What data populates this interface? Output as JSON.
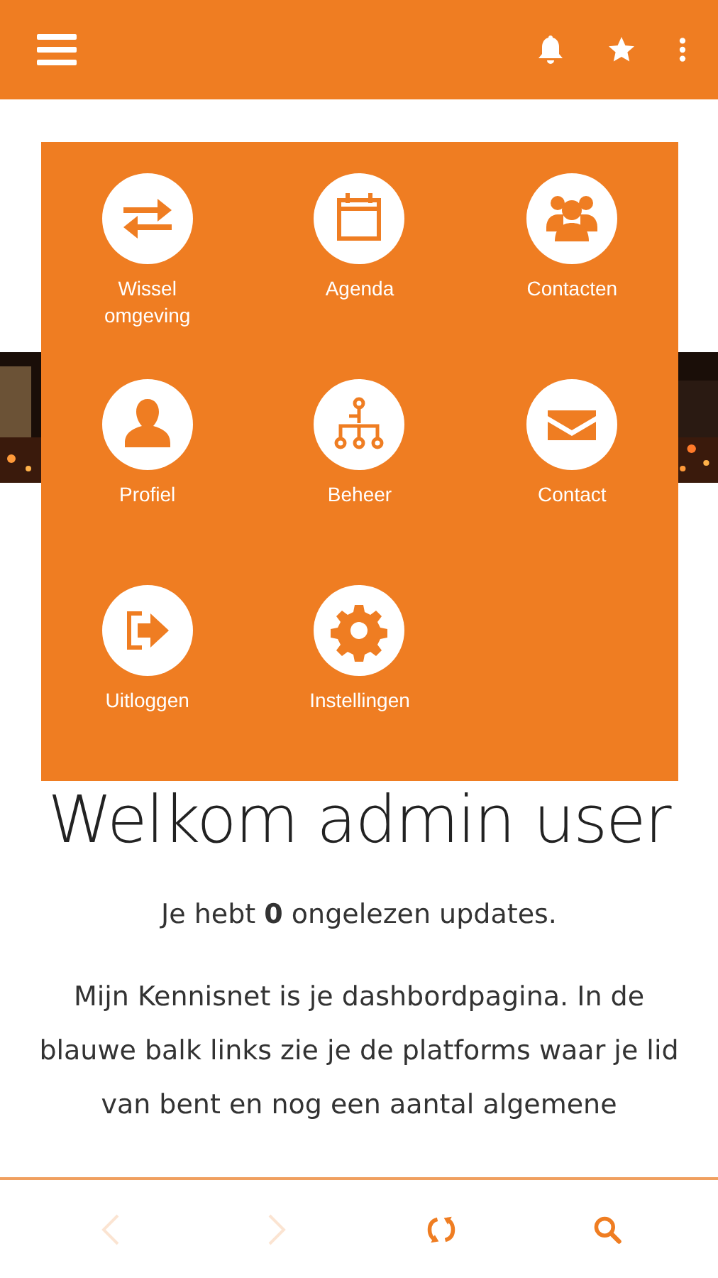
{
  "header": {
    "actions": [
      {
        "kind": "bell"
      },
      {
        "kind": "star"
      },
      {
        "kind": "more"
      }
    ]
  },
  "page": {
    "welcome": "Welkom admin user",
    "updates": "Je hebt **0** ongelezen updates.",
    "intro": "Mijn Kennisnet is je dashbordpagina. In de blauwe balk links zie je de platforms waar je lid van bent en nog een aantal algemene"
  },
  "menu": {
    "items": [
      {
        "label": "Wissel omgeving",
        "kind": "swap"
      },
      {
        "label": "Agenda",
        "kind": "calendar"
      },
      {
        "label": "Contacten",
        "kind": "group"
      },
      {
        "label": "Profiel",
        "kind": "person"
      },
      {
        "label": "Beheer",
        "kind": "tree"
      },
      {
        "label": "Contact",
        "kind": "mail"
      },
      {
        "label": "Uitloggen",
        "kind": "logout"
      },
      {
        "label": "Instellingen",
        "kind": "gear"
      }
    ]
  },
  "bottom_bar": [
    {
      "kind": "back",
      "disabled": true
    },
    {
      "kind": "forward",
      "disabled": true
    },
    {
      "kind": "refresh",
      "disabled": false
    },
    {
      "kind": "search",
      "disabled": false
    }
  ]
}
